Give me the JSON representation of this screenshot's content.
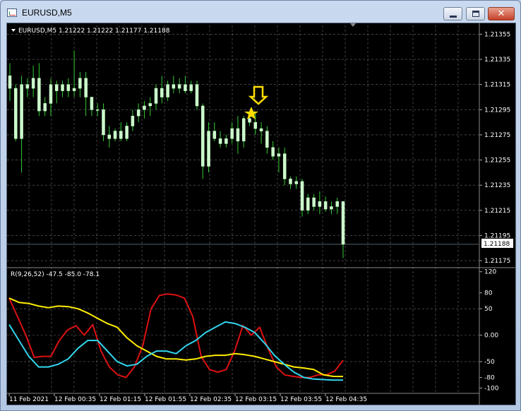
{
  "window": {
    "title": "EURUSD,M5",
    "close_glyph": "✕",
    "icons": {
      "app": "chart-window-icon",
      "minimize": "minimize-icon",
      "maximize": "maximize-icon",
      "close": "close-icon"
    }
  },
  "main_chart": {
    "header": "EURUSD,M5  1.21222 1.21222 1.21177 1.21188",
    "current_price": "1.21188",
    "price_axis": [
      "1.21355",
      "1.21335",
      "1.21315",
      "1.21295",
      "1.21275",
      "1.21255",
      "1.21235",
      "1.21215",
      "1.21195",
      "1.21175"
    ]
  },
  "indicator": {
    "header": "R(9,26,52) -47.5 -85.0 -78.1",
    "axis": [
      "120",
      "80",
      "50",
      "0.00",
      "-50",
      "-80",
      "-100"
    ]
  },
  "time_axis": [
    "11 Feb 2021",
    "12 Feb 00:35",
    "12 Feb 01:15",
    "12 Feb 01:55",
    "12 Feb 02:35",
    "12 Feb 03:15",
    "12 Feb 03:55",
    "12 Feb 04:35"
  ],
  "colors": {
    "background": "#000000",
    "grid": "#c0c0c0",
    "candle": "#ccffcc",
    "wick": "#33cc33",
    "line_red": "#dd1111",
    "line_yellow": "#ffee00",
    "line_cyan": "#33d6ee",
    "arrow": "#ffdd00"
  },
  "chart_data": {
    "type": "candlestick",
    "ohlc": [
      [
        1.21322,
        1.21332,
        1.21302,
        1.21312
      ],
      [
        1.21312,
        1.21315,
        1.2127,
        1.21272
      ],
      [
        1.21272,
        1.21322,
        1.21245,
        1.21315
      ],
      [
        1.21315,
        1.2132,
        1.21305,
        1.21312
      ],
      [
        1.21312,
        1.2133,
        1.21305,
        1.2132
      ],
      [
        1.2132,
        1.21332,
        1.2129,
        1.21294
      ],
      [
        1.21294,
        1.21305,
        1.2129,
        1.213
      ],
      [
        1.213,
        1.2132,
        1.2129,
        1.21315
      ],
      [
        1.21315,
        1.21318,
        1.213,
        1.2131
      ],
      [
        1.2131,
        1.21318,
        1.21305,
        1.21315
      ],
      [
        1.21315,
        1.2132,
        1.21305,
        1.2131
      ],
      [
        1.2131,
        1.21342,
        1.21305,
        1.21312
      ],
      [
        1.21312,
        1.21325,
        1.21305,
        1.2132
      ],
      [
        1.2132,
        1.21325,
        1.2129,
        1.21305
      ],
      [
        1.21305,
        1.21305,
        1.2129,
        1.21295
      ],
      [
        1.21295,
        1.213,
        1.2129,
        1.21295
      ],
      [
        1.21295,
        1.213,
        1.2127,
        1.21275
      ],
      [
        1.21275,
        1.21282,
        1.21265,
        1.21272
      ],
      [
        1.21272,
        1.2128,
        1.2127,
        1.21278
      ],
      [
        1.21278,
        1.21285,
        1.2127,
        1.21272
      ],
      [
        1.21272,
        1.21285,
        1.2127,
        1.21282
      ],
      [
        1.21282,
        1.21295,
        1.21278,
        1.2129
      ],
      [
        1.2129,
        1.213,
        1.21285,
        1.21295
      ],
      [
        1.21295,
        1.21302,
        1.21288,
        1.21298
      ],
      [
        1.21298,
        1.21305,
        1.2129,
        1.213
      ],
      [
        1.213,
        1.21315,
        1.21295,
        1.21312
      ],
      [
        1.21312,
        1.21322,
        1.213,
        1.21305
      ],
      [
        1.21305,
        1.21318,
        1.21302,
        1.21315
      ],
      [
        1.21315,
        1.21322,
        1.21308,
        1.21312
      ],
      [
        1.21312,
        1.2132,
        1.21308,
        1.21315
      ],
      [
        1.21315,
        1.21322,
        1.21308,
        1.2131
      ],
      [
        1.2131,
        1.21318,
        1.21308,
        1.21315
      ],
      [
        1.21315,
        1.21318,
        1.21295,
        1.21298
      ],
      [
        1.21298,
        1.213,
        1.2124,
        1.2125
      ],
      [
        1.2125,
        1.21285,
        1.21245,
        1.21278
      ],
      [
        1.21278,
        1.21285,
        1.2127,
        1.21272
      ],
      [
        1.21272,
        1.21278,
        1.21265,
        1.21268
      ],
      [
        1.21268,
        1.21275,
        1.21265,
        1.21272
      ],
      [
        1.21272,
        1.21285,
        1.21268,
        1.2128
      ],
      [
        1.2128,
        1.2129,
        1.2126,
        1.2127
      ],
      [
        1.2127,
        1.2129,
        1.21265,
        1.21288
      ],
      [
        1.21288,
        1.2129,
        1.21282,
        1.21285
      ],
      [
        1.21285,
        1.21292,
        1.21275,
        1.2128
      ],
      [
        1.2128,
        1.21285,
        1.21268,
        1.21278
      ],
      [
        1.21278,
        1.21282,
        1.2126,
        1.21265
      ],
      [
        1.21265,
        1.2127,
        1.21255,
        1.21258
      ],
      [
        1.21258,
        1.21265,
        1.21245,
        1.2126
      ],
      [
        1.2126,
        1.21265,
        1.21235,
        1.2124
      ],
      [
        1.2124,
        1.21242,
        1.21232,
        1.21236
      ],
      [
        1.21236,
        1.21242,
        1.21232,
        1.21238
      ],
      [
        1.21238,
        1.2124,
        1.2121,
        1.21215
      ],
      [
        1.21215,
        1.21228,
        1.21212,
        1.21225
      ],
      [
        1.21225,
        1.21228,
        1.21215,
        1.21218
      ],
      [
        1.21218,
        1.2123,
        1.21212,
        1.21222
      ],
      [
        1.21222,
        1.21226,
        1.21214,
        1.21216
      ],
      [
        1.21216,
        1.21222,
        1.21212,
        1.21218
      ],
      [
        1.21218,
        1.21225,
        1.21212,
        1.21222
      ],
      [
        1.21222,
        1.21222,
        1.21177,
        1.21188
      ]
    ],
    "y_range": [
      1.2117,
      1.21362
    ],
    "indicator_lines": [
      {
        "color": "#dd1111",
        "values": [
          70,
          35,
          0,
          -42,
          -40,
          -40,
          -10,
          10,
          18,
          0,
          20,
          -30,
          -60,
          -75,
          -80,
          -60,
          -20,
          50,
          75,
          78,
          76,
          70,
          35,
          -40,
          -65,
          -70,
          -65,
          -30,
          18,
          0,
          15,
          -25,
          -60,
          -75,
          -78,
          -80,
          -80,
          -75,
          -75,
          -68,
          -47.5
        ]
      },
      {
        "color": "#ffee00",
        "values": [
          70,
          62,
          60,
          55,
          52,
          55,
          54,
          50,
          42,
          32,
          22,
          15,
          -5,
          -20,
          -30,
          -40,
          -45,
          -45,
          -47,
          -45,
          -40,
          -38,
          -38,
          -35,
          -37,
          -40,
          -45,
          -50,
          -55,
          -60,
          -62,
          -65,
          -75,
          -78,
          -78.1
        ]
      },
      {
        "color": "#33d6ee",
        "values": [
          20,
          -10,
          -40,
          -60,
          -60,
          -55,
          -45,
          -25,
          -10,
          -10,
          -30,
          -50,
          -58,
          -55,
          -40,
          -30,
          -30,
          -35,
          -20,
          -10,
          5,
          15,
          25,
          22,
          15,
          5,
          -15,
          -38,
          -55,
          -70,
          -80,
          -83,
          -84,
          -85,
          -85.0
        ]
      }
    ],
    "indicator_range": [
      -110,
      125
    ]
  }
}
